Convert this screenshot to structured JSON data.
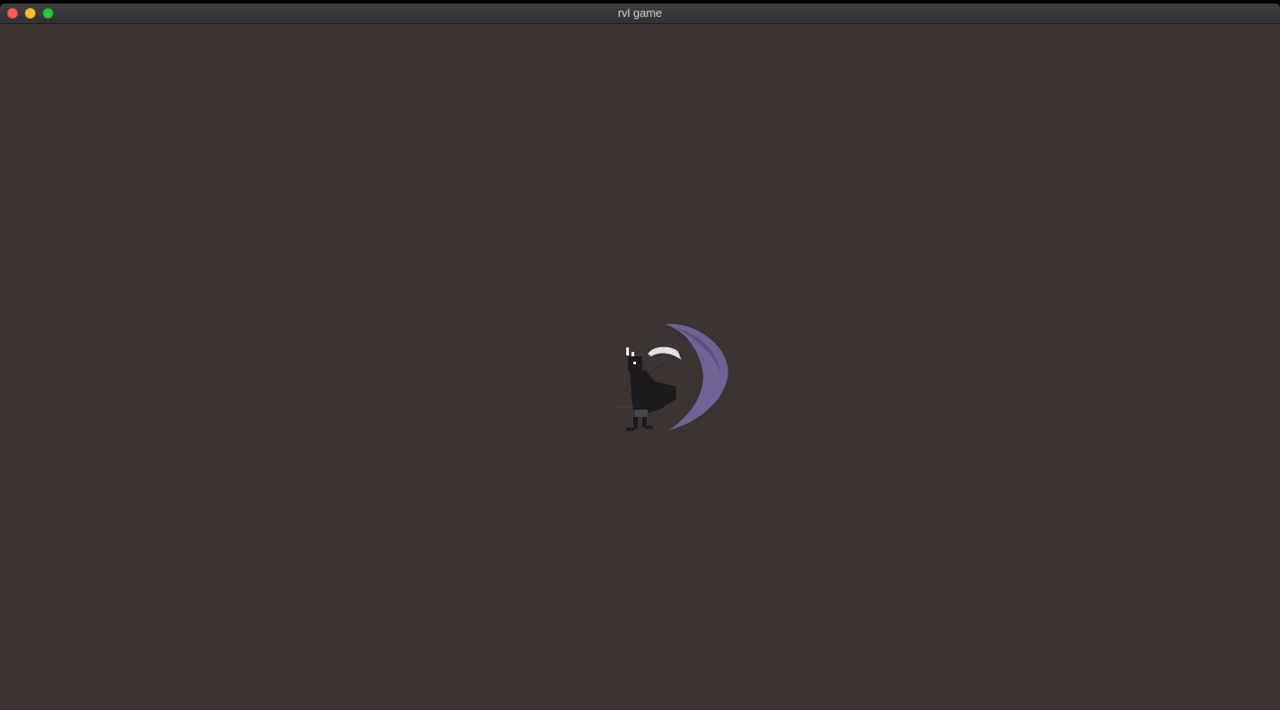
{
  "window": {
    "title": "rvl game"
  },
  "colors": {
    "background": "#3c3333",
    "slash": "#6e6296",
    "character": "#1c1a1c",
    "highlight": "#dcdcdc"
  },
  "scene": {
    "sprite_icon": "scythe-wielding-character"
  }
}
